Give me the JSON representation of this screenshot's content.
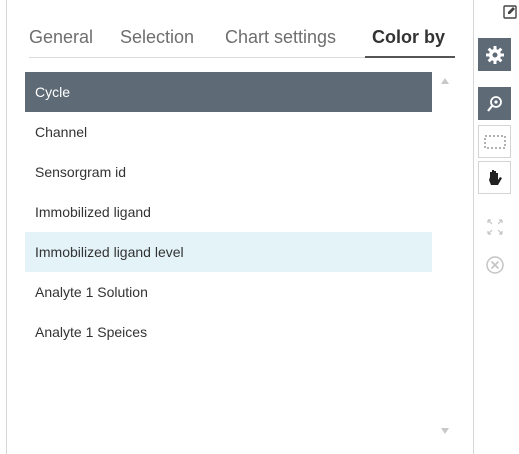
{
  "tabs": [
    {
      "label": "General"
    },
    {
      "label": "Selection"
    },
    {
      "label": "Chart settings"
    },
    {
      "label": "Color by"
    }
  ],
  "color_by_options": [
    {
      "label": "Cycle",
      "state": "selected"
    },
    {
      "label": "Channel",
      "state": "normal"
    },
    {
      "label": "Sensorgram id",
      "state": "normal"
    },
    {
      "label": "Immobilized ligand",
      "state": "normal"
    },
    {
      "label": "Immobilized ligand level",
      "state": "hovered"
    },
    {
      "label": "Analyte 1 Solution",
      "state": "normal"
    },
    {
      "label": "Analyte 1 Speices",
      "state": "normal"
    }
  ],
  "toolbar": {
    "icons": [
      "edit-icon",
      "gear-icon",
      "zoom-select-icon",
      "rectangle-select-icon",
      "pan-hand-icon",
      "fit-expand-icon",
      "close-circle-icon"
    ]
  },
  "colors": {
    "selected_row": "#5e6a75",
    "hover_row": "#e3f3f8",
    "toolbar_dark": "#5e6a75"
  }
}
